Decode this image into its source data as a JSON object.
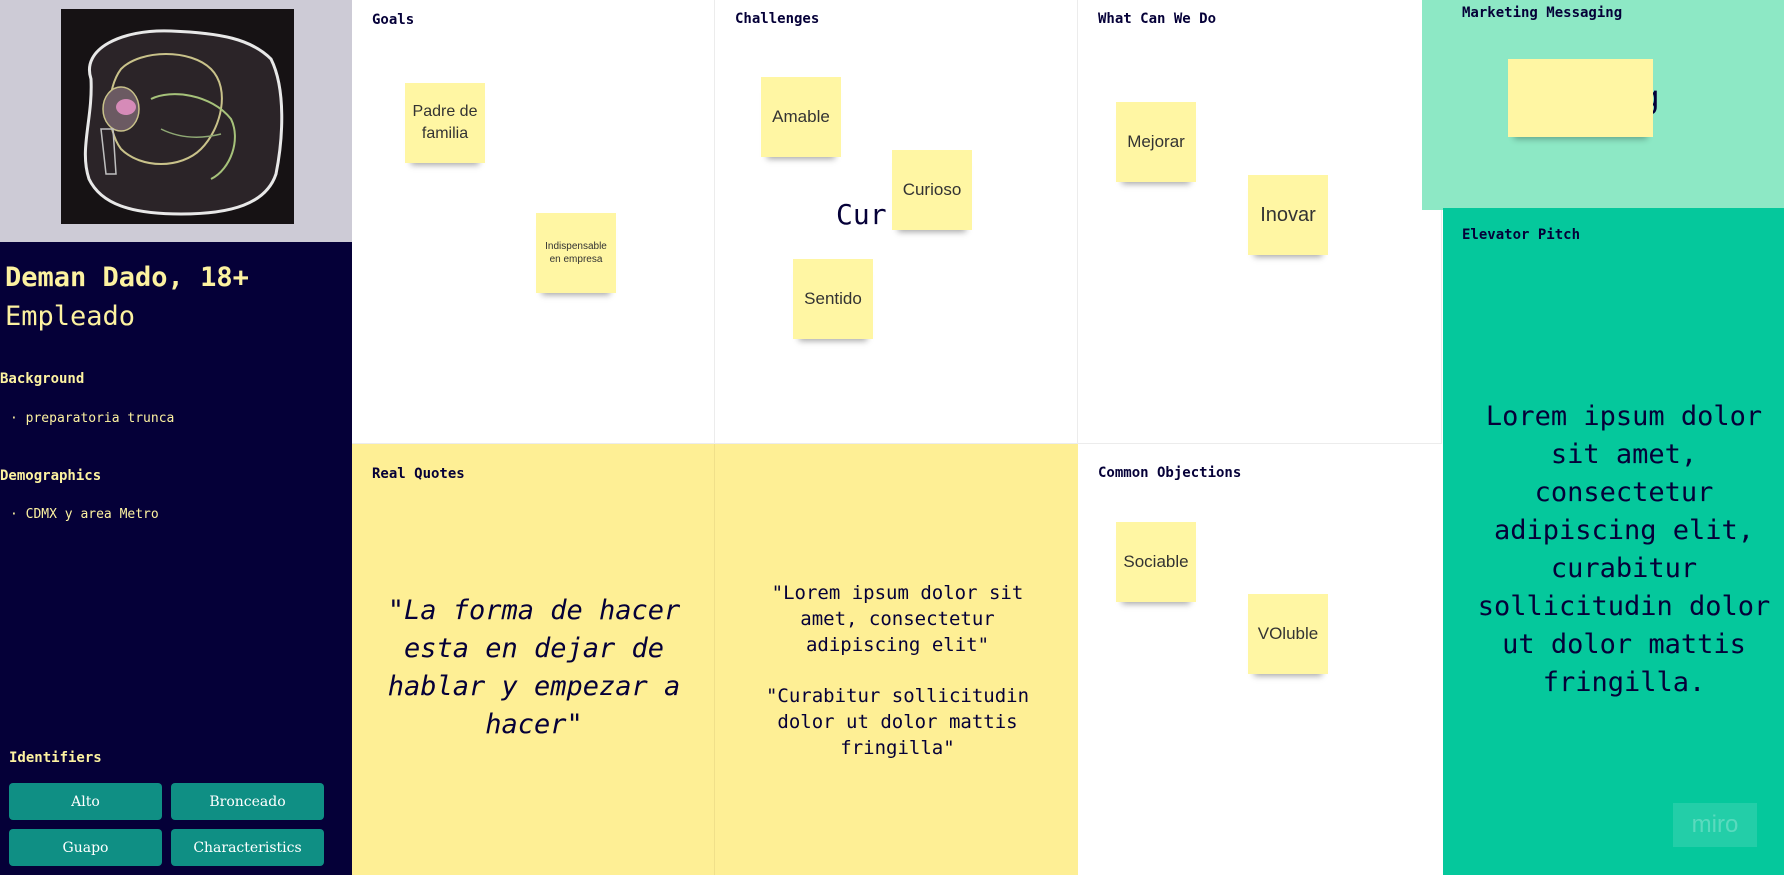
{
  "persona": {
    "name": "Deman Dado, 18+",
    "role": "Empleado",
    "background": {
      "title": "Background",
      "items": [
        "preparatoria trunca"
      ]
    },
    "demographics": {
      "title": "Demographics",
      "items": [
        "CDMX y area Metro"
      ]
    },
    "identifiers": {
      "title": "Identifiers",
      "chips": [
        "Alto",
        "Bronceado",
        "Guapo",
        "Characteristics"
      ]
    }
  },
  "goals": {
    "title": "Goals",
    "stickies": [
      "Padre de familia",
      "Indispensable en empresa"
    ]
  },
  "challenges": {
    "title": "Challenges",
    "background_text": "Cur",
    "stickies": [
      "Amable",
      "Curioso",
      "Sentido"
    ]
  },
  "what_can_we_do": {
    "title": "What Can We Do",
    "stickies": [
      "Mejorar",
      "Inovar"
    ]
  },
  "marketing": {
    "title": "Marketing Messaging",
    "background_text": "g"
  },
  "elevator": {
    "title": "Elevator Pitch",
    "text": "Lorem ipsum dolor sit amet, consectetur adipiscing elit, curabitur sollicitudin dolor ut dolor mattis fringilla."
  },
  "real_quotes": {
    "title": "Real Quotes",
    "quote": "\"La forma de hacer esta en dejar de hablar y empezar a hacer\"",
    "quote2": "\"Lorem ipsum dolor sit amet, consectetur adipiscing elit\"",
    "quote3": "\"Curabitur sollicitudin dolor ut dolor mattis fringilla\""
  },
  "objections": {
    "title": "Common Objections",
    "stickies": [
      "Sociable",
      "VOluble"
    ]
  },
  "watermark": "miro",
  "colors": {
    "navy": "#050038",
    "pale_yellow": "#fdf2a0",
    "sticky_yellow": "#fff6a3",
    "quote_yellow": "#feef95",
    "mint": "#8de8c5",
    "teal": "#05c89c",
    "chip_teal": "#0f8f84"
  }
}
